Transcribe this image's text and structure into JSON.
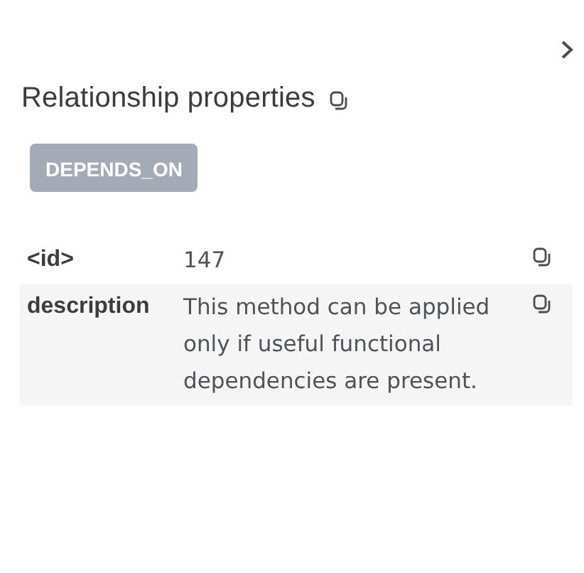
{
  "panel": {
    "title": "Relationship properties",
    "relationship_type": "DEPENDS_ON"
  },
  "properties": [
    {
      "key": "<id>",
      "value": "147"
    },
    {
      "key": "description",
      "value": "This method can be applied only if useful functional dependencies are present."
    }
  ]
}
